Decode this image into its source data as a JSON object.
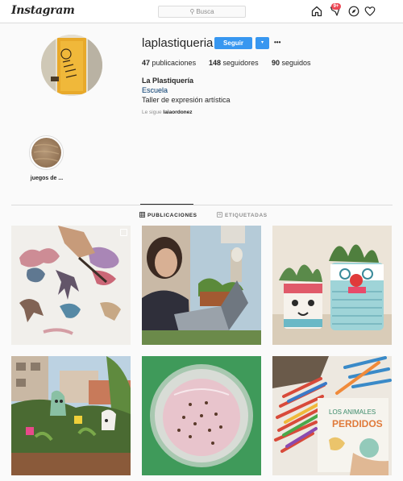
{
  "header": {
    "logo": "Instagram",
    "search_placeholder": "Busca",
    "notification_count": "9+",
    "icons": [
      "home-icon",
      "activity-icon",
      "explore-icon",
      "heart-icon"
    ]
  },
  "profile": {
    "username": "laplastiqueria",
    "follow_label": "Seguir",
    "dropdown_label": "▾",
    "more_label": "•••",
    "posts_count": "47",
    "posts_label": "publicaciones",
    "followers_count": "148",
    "followers_label": "seguidores",
    "following_count": "90",
    "following_label": "seguidos",
    "full_name": "La Plastiquería",
    "category": "Escuela",
    "bio": "Taller de expresión artística",
    "followed_by_prefix": "Le sigue",
    "followed_by_user": "laiaordonez",
    "avatar_text": "La Plastiquería"
  },
  "highlights": [
    {
      "label": "juegos de ..."
    }
  ],
  "tabs": [
    {
      "label": "PUBLICACIONES",
      "active": true,
      "icon": "grid-icon"
    },
    {
      "label": "ETIQUETADAS",
      "active": false,
      "icon": "tagged-icon"
    }
  ],
  "posts": [
    {
      "subject": "ink-blot-painting",
      "multi": true
    },
    {
      "subject": "woman-with-laptop",
      "multi": false
    },
    {
      "subject": "painted-cans-with-succulents",
      "multi": false
    },
    {
      "subject": "toy-animals-in-plants",
      "multi": false
    },
    {
      "subject": "bowl-of-seeds",
      "multi": false
    },
    {
      "subject": "coloured-pencils-book",
      "multi": false
    }
  ],
  "book_cover_text": [
    "LOS ANIMALES",
    "PERDIDOS"
  ],
  "colors": {
    "accent": "#3897f0",
    "badge": "#ed4956",
    "muted": "#8e8e8e",
    "link": "#00376b"
  }
}
